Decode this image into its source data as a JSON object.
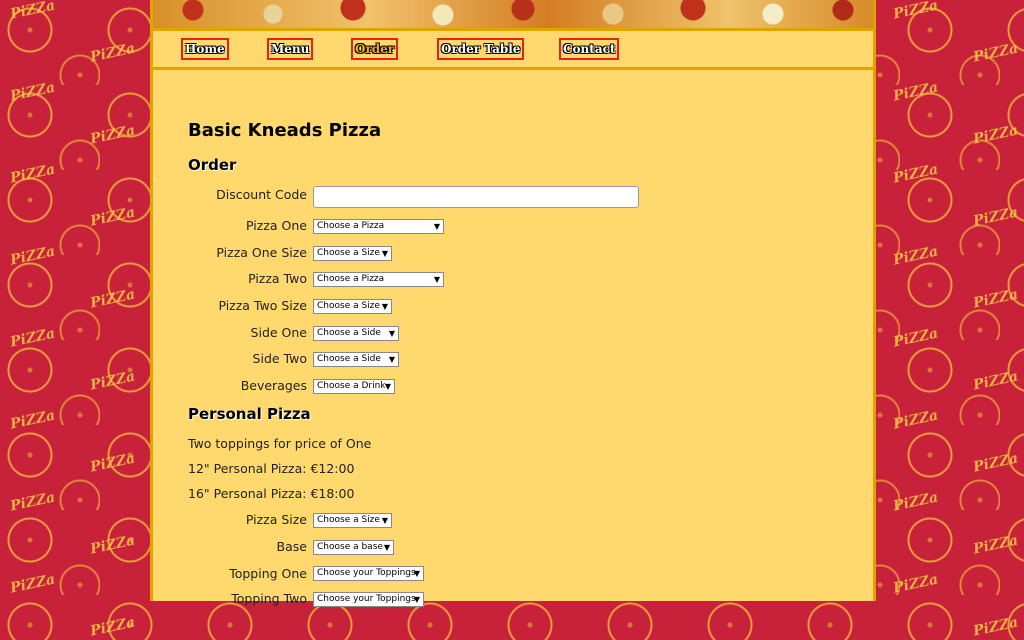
{
  "background": {
    "pattern_word": "PiZZa",
    "colors": {
      "background": "#c8213a",
      "pattern": "#f0c847",
      "content": "#ffd96d",
      "border": "#e0a300",
      "nav_border": "#e3241b"
    }
  },
  "nav": {
    "items": [
      {
        "label": "Home"
      },
      {
        "label": "Menu"
      },
      {
        "label": "Order",
        "active": true
      },
      {
        "label": "Order Table"
      },
      {
        "label": "Contact"
      }
    ]
  },
  "page": {
    "title": "Basic Kneads Pizza",
    "order_heading": "Order",
    "personal_heading": "Personal Pizza"
  },
  "order_form": {
    "discount_label": "Discount Code",
    "discount_value": "",
    "fields": [
      {
        "label": "Pizza One",
        "selected": "Choose a Pizza"
      },
      {
        "label": "Pizza One Size",
        "selected": "Choose a Size"
      },
      {
        "label": "Pizza Two",
        "selected": "Choose a Pizza"
      },
      {
        "label": "Pizza Two Size",
        "selected": "Choose a Size"
      },
      {
        "label": "Side One",
        "selected": "Choose a Side"
      },
      {
        "label": "Side Two",
        "selected": "Choose a Side"
      },
      {
        "label": "Beverages",
        "selected": "Choose a Drink"
      }
    ]
  },
  "personal_pizza": {
    "promo": "Two toppings for price of One",
    "price_12": "12\" Personal Pizza: €12:00",
    "price_16": "16\" Personal Pizza: €18:00",
    "fields": [
      {
        "label": "Pizza Size",
        "selected": "Choose a Size"
      },
      {
        "label": "Base",
        "selected": "Choose a base"
      },
      {
        "label": "Topping One",
        "selected": "Choose your Toppings"
      },
      {
        "label": "Topping Two",
        "selected": "Choose your Toppings"
      }
    ]
  }
}
